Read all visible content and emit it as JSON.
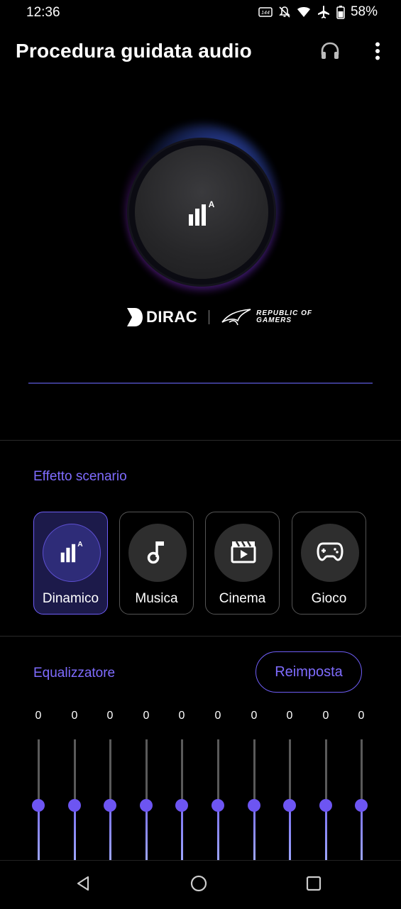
{
  "status": {
    "time": "12:36",
    "icons": [
      "hd-voice-icon",
      "muted-bell-icon",
      "wifi-icon",
      "airplane-icon",
      "battery-icon"
    ],
    "battery": "58%"
  },
  "header": {
    "title": "Procedura guidata audio",
    "icons": [
      "headphones-icon",
      "more-vert-icon"
    ]
  },
  "hero": {
    "knob_icon": "dynamic-eq-icon",
    "dirac": "DIRAC",
    "rog_line1": "REPUBLIC OF",
    "rog_line2": "GAMERS"
  },
  "scenario": {
    "label": "Effetto scenario",
    "options": [
      {
        "label": "Dinamico",
        "icon": "dynamic-icon",
        "selected": true
      },
      {
        "label": "Musica",
        "icon": "music-note-icon",
        "selected": false
      },
      {
        "label": "Cinema",
        "icon": "clapperboard-icon",
        "selected": false
      },
      {
        "label": "Gioco",
        "icon": "gamepad-icon",
        "selected": false
      }
    ]
  },
  "equalizer": {
    "label": "Equalizzatore",
    "reset_label": "Reimposta",
    "bands": [
      "0",
      "0",
      "0",
      "0",
      "0",
      "0",
      "0",
      "0",
      "0",
      "0"
    ]
  },
  "colors": {
    "accent": "#7f6cff",
    "thumb": "#6d55f2",
    "background": "#000000"
  }
}
